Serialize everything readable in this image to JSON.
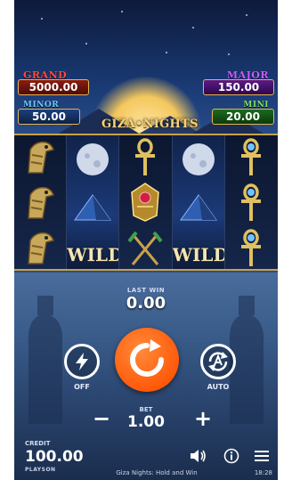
{
  "jackpots": {
    "grand": {
      "label": "GRAND",
      "value": "5000.00"
    },
    "minor": {
      "label": "MINOR",
      "value": "50.00"
    },
    "major": {
      "label": "MAJOR",
      "value": "150.00"
    },
    "mini": {
      "label": "MINI",
      "value": "20.00"
    }
  },
  "logo": "GIZA•NIGHTS",
  "reels": {
    "wild_label": "WILD",
    "symbols": [
      [
        "falcon-icon",
        "falcon-icon",
        "falcon-icon"
      ],
      [
        "moon-icon",
        "pyramid-icon",
        "wild-icon"
      ],
      [
        "ankh-icon",
        "scarab-icon",
        "crossed-staffs-icon"
      ],
      [
        "moon-icon",
        "pyramid-icon",
        "wild-icon"
      ],
      [
        "ankh-icon",
        "ankh-icon",
        "ankh-icon"
      ]
    ]
  },
  "win": {
    "label": "LAST WIN",
    "value": "0.00"
  },
  "controls": {
    "turbo_label": "OFF",
    "auto_label": "AUTO",
    "bet_label": "BET",
    "bet_value": "1.00",
    "minus": "−",
    "plus": "+"
  },
  "footer": {
    "credit_label": "CREDIT",
    "credit_value": "100.00",
    "brand": "PLAYSON",
    "game_name": "Giza Nights: Hold and Win",
    "clock": "18:28"
  },
  "colors": {
    "spin": "#ff5a0a",
    "gold": "#e6b450",
    "grand": "#ff4a3d",
    "major": "#c55dff",
    "minor": "#6cc7ff",
    "mini": "#7ae35a"
  }
}
